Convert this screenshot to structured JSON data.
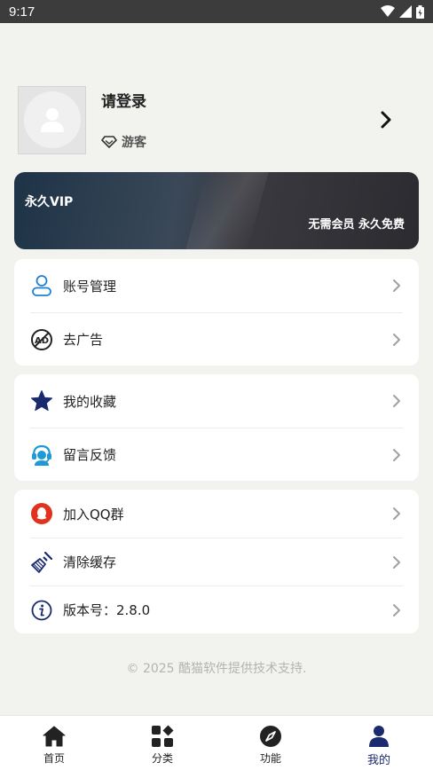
{
  "status_bar": {
    "time": "9:17"
  },
  "profile": {
    "title": "请登录",
    "role": "游客"
  },
  "vip": {
    "title": "永久VIP",
    "subtitle": "无需会员 永久免费"
  },
  "groups": [
    {
      "items": [
        {
          "label": "账号管理",
          "icon": "person-outline-icon"
        },
        {
          "label": "去广告",
          "icon": "no-ad-icon"
        }
      ]
    },
    {
      "items": [
        {
          "label": "我的收藏",
          "icon": "star-icon"
        },
        {
          "label": "留言反馈",
          "icon": "headset-support-icon"
        }
      ]
    },
    {
      "items": [
        {
          "label": "加入QQ群",
          "icon": "qq-icon"
        },
        {
          "label": "清除缓存",
          "icon": "broom-icon"
        },
        {
          "label": "版本号：2.8.0",
          "icon": "info-icon"
        }
      ]
    }
  ],
  "footer": "© 2025 酷猫软件提供技术支持.",
  "nav": [
    {
      "label": "首页",
      "icon": "home-icon"
    },
    {
      "label": "分类",
      "icon": "category-icon"
    },
    {
      "label": "功能",
      "icon": "compass-icon"
    },
    {
      "label": "我的",
      "icon": "profile-icon",
      "active": true
    }
  ],
  "colors": {
    "accent": "#1a2a6e",
    "icon_blue": "#1e7fd6",
    "qq_red": "#e0321c",
    "background": "#f2f2ef"
  }
}
